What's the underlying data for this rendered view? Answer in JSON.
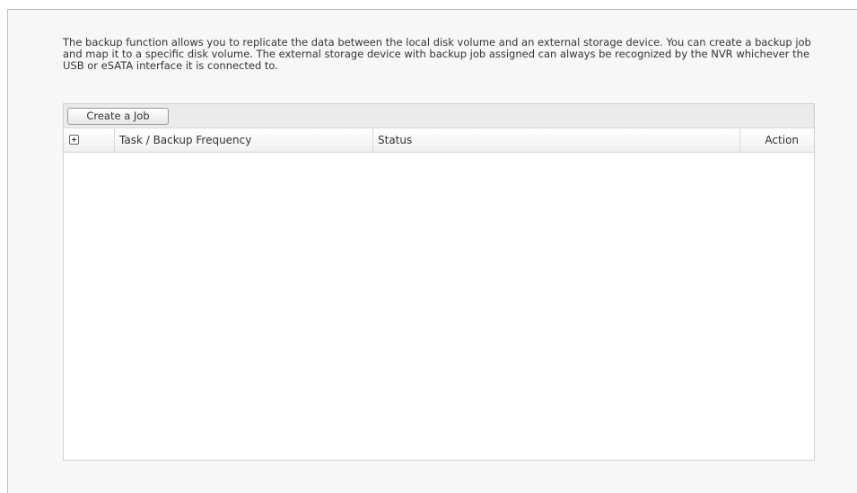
{
  "description": "The backup function allows you to replicate the data between the local disk volume and an external storage device. You can create a backup job and map it to a specific disk volume. The external storage device with backup job assigned can always be recognized by the NVR whichever the USB or eSATA interface it is connected to.",
  "toolbar": {
    "create_job_label": "Create a Job"
  },
  "table": {
    "columns": {
      "expand_icon": "plus-square-icon",
      "task": "Task / Backup Frequency",
      "status": "Status",
      "action": "Action"
    },
    "rows": []
  }
}
